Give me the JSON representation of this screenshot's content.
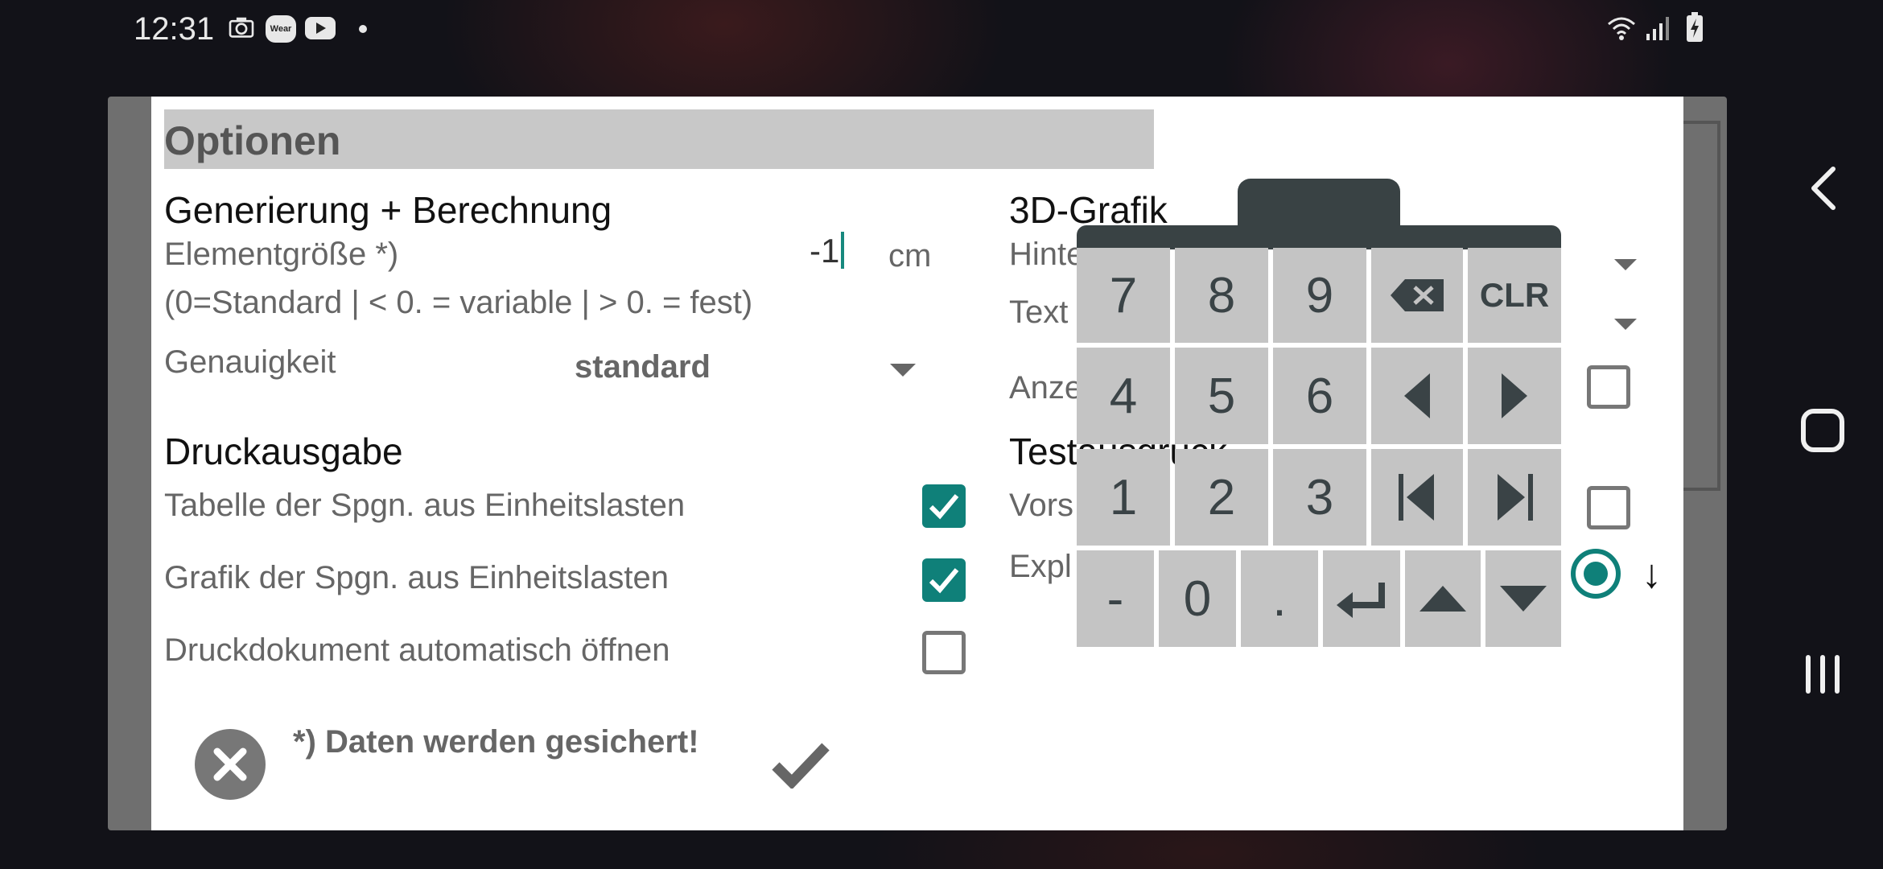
{
  "status_bar": {
    "time": "12:31",
    "left_icons": [
      "camera-icon",
      "wear-icon",
      "youtube-icon",
      "dot-icon"
    ],
    "wear_label": "Wear",
    "right_icons": [
      "wifi-icon",
      "signal-icon",
      "battery-charging-icon"
    ]
  },
  "dialog": {
    "title": "Optionen",
    "left": {
      "section1": "Generierung + Berechnung",
      "element_size_label": "Elementgröße *)",
      "element_size_value": "-1",
      "element_size_unit": "cm",
      "element_size_hint": "(0=Standard | < 0. = variable | > 0. = fest)",
      "accuracy_label": "Genauigkeit",
      "accuracy_value": "standard",
      "section2": "Druckausgabe",
      "print_options": [
        {
          "label": "Tabelle der Spgn. aus Einheitslasten",
          "checked": true
        },
        {
          "label": "Grafik der Spgn. aus Einheitslasten",
          "checked": true
        },
        {
          "label": "Druckdokument automatisch öffnen",
          "checked": false
        }
      ]
    },
    "right": {
      "section1": "3D-Grafik",
      "partial_hint_1": "Hinte",
      "partial_hint_2": "Text",
      "partial_hint_3": "Anze",
      "section2": "Testausgruck",
      "partial_hint_4": "Vors",
      "partial_hint_5": "Expl",
      "arrow_symbol": "↓"
    },
    "footnote": "*) Daten werden gesichert!"
  },
  "keypad": {
    "rows": [
      [
        "7",
        "8",
        "9",
        "⌫",
        "CLR"
      ],
      [
        "4",
        "5",
        "6",
        "◀",
        "▶"
      ],
      [
        "1",
        "2",
        "3",
        "⏮",
        "⏭"
      ],
      [
        "-",
        "0",
        ".",
        "↵",
        "▲",
        "▼"
      ]
    ]
  },
  "colors": {
    "accent": "#0f8079",
    "keypad_key": "#c4c4c4",
    "keypad_header": "#394244"
  }
}
